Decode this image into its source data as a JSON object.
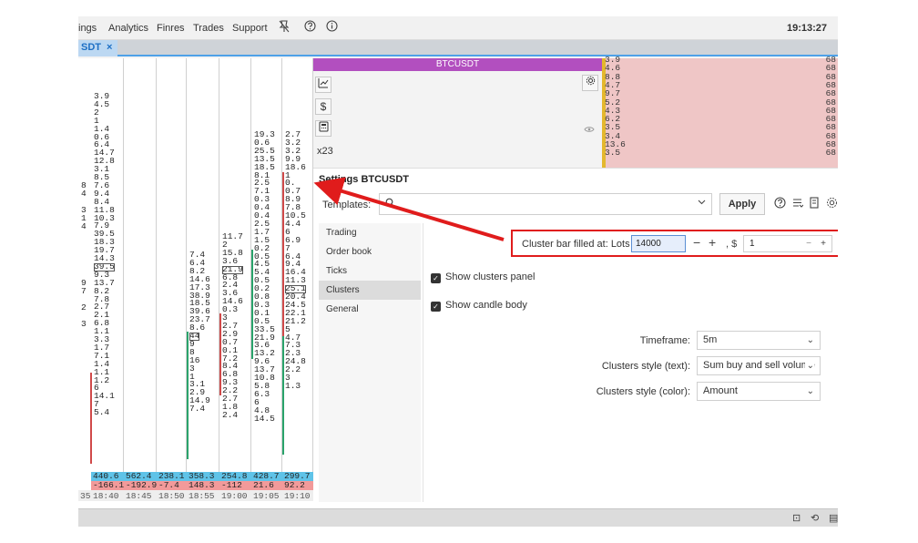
{
  "menu": {
    "items": [
      "ings",
      "Analytics",
      "Finres",
      "Trades",
      "Support"
    ],
    "clock": "19:13:27"
  },
  "tab": {
    "label": "SDT",
    "close": "×"
  },
  "cluster": {
    "columns": [
      {
        "cells": [
          {
            "t": "3.9"
          },
          {
            "t": "4.5"
          },
          {
            "t": "2"
          },
          {
            "t": "1"
          },
          {
            "t": "1.4"
          },
          {
            "t": "0.6"
          },
          {
            "t": "6.4"
          },
          {
            "t": "14.7"
          },
          {
            "t": "12.8"
          },
          {
            "t": "3.1"
          },
          {
            "t": "8.5"
          },
          {
            "t": "7.6"
          },
          {
            "t": "9.4"
          },
          {
            "t": "8.4"
          },
          {
            "t": "11.8"
          },
          {
            "t": "10.3"
          },
          {
            "t": "7.9"
          },
          {
            "t": "39.5"
          },
          {
            "t": "18.3"
          },
          {
            "t": "19.7"
          },
          {
            "t": "14.3"
          },
          {
            "t": "39.5",
            "box": true
          },
          {
            "t": "9.3"
          },
          {
            "t": "13.7"
          },
          {
            "t": "8.2"
          },
          {
            "t": "7.8"
          },
          {
            "t": "2.7"
          },
          {
            "t": "2.1"
          },
          {
            "t": "6.8"
          },
          {
            "t": "1.1"
          },
          {
            "t": "3.3"
          },
          {
            "t": "1.7"
          },
          {
            "t": "7.1"
          },
          {
            "t": "1.4"
          },
          {
            "t": "1.1"
          },
          {
            "t": "1.2"
          },
          {
            "t": "6"
          },
          {
            "t": "14.1"
          },
          {
            "t": "7"
          },
          {
            "t": "5.4"
          }
        ]
      },
      {
        "cells": []
      },
      {
        "cells": []
      },
      {
        "cells": [
          {
            "t": "7.4"
          },
          {
            "t": "6.4"
          },
          {
            "t": "8.2"
          },
          {
            "t": "14.6"
          },
          {
            "t": "17.3"
          },
          {
            "t": "38.9"
          },
          {
            "t": "18.5"
          },
          {
            "t": "39.6"
          },
          {
            "t": "23.7"
          },
          {
            "t": "8.6"
          },
          {
            "t": "44",
            "box": true
          },
          {
            "t": "9"
          },
          {
            "t": "8"
          },
          {
            "t": "16"
          },
          {
            "t": "3"
          },
          {
            "t": "1"
          },
          {
            "t": "3.1"
          },
          {
            "t": "2.9"
          },
          {
            "t": "14.9"
          },
          {
            "t": "7.4"
          }
        ]
      },
      {
        "cells": [
          {
            "t": "11.7"
          },
          {
            "t": "2"
          },
          {
            "t": "15.8"
          },
          {
            "t": "3.6"
          },
          {
            "t": "21.9",
            "box": true
          },
          {
            "t": "6.8"
          },
          {
            "t": "2.4"
          },
          {
            "t": "3.6"
          },
          {
            "t": "14.6"
          },
          {
            "t": "0.3"
          },
          {
            "t": "3"
          },
          {
            "t": "2.7"
          },
          {
            "t": "2.9"
          },
          {
            "t": "0.7"
          },
          {
            "t": "0.1"
          },
          {
            "t": "7.2"
          },
          {
            "t": "8.4"
          },
          {
            "t": "6.8"
          },
          {
            "t": "9.3"
          },
          {
            "t": "2.2"
          },
          {
            "t": "2.7"
          },
          {
            "t": "1.8"
          },
          {
            "t": "2.4"
          }
        ]
      },
      {
        "cells": [
          {
            "t": "19.3"
          },
          {
            "t": "0.6"
          },
          {
            "t": "25.5"
          },
          {
            "t": "13.5"
          },
          {
            "t": "18.5"
          },
          {
            "t": "8.1"
          },
          {
            "t": "2.5"
          },
          {
            "t": "7.1"
          },
          {
            "t": "0.3"
          },
          {
            "t": "0.4"
          },
          {
            "t": "0.4"
          },
          {
            "t": "2.5"
          },
          {
            "t": "1.7"
          },
          {
            "t": "1.5"
          },
          {
            "t": "0.2"
          },
          {
            "t": "0.5"
          },
          {
            "t": "4.5"
          },
          {
            "t": "5.4"
          },
          {
            "t": "0.5"
          },
          {
            "t": "0.2"
          },
          {
            "t": "0.8"
          },
          {
            "t": "0.3"
          },
          {
            "t": "0.1"
          },
          {
            "t": "0.5"
          },
          {
            "t": "33.5"
          },
          {
            "t": "21.9"
          },
          {
            "t": "3.6"
          },
          {
            "t": "13.2"
          },
          {
            "t": "9.6"
          },
          {
            "t": "13.7"
          },
          {
            "t": "10.8"
          },
          {
            "t": "5.8"
          },
          {
            "t": "6.3"
          },
          {
            "t": "6"
          },
          {
            "t": "4.8"
          },
          {
            "t": "14.5"
          }
        ]
      },
      {
        "cells": [
          {
            "t": "2.7"
          },
          {
            "t": "3.2"
          },
          {
            "t": "3.2"
          },
          {
            "t": "9.9"
          },
          {
            "t": "18.6"
          },
          {
            "t": "1"
          },
          {
            "t": "0."
          },
          {
            "t": "0.7"
          },
          {
            "t": "8.9"
          },
          {
            "t": "7.8"
          },
          {
            "t": "10.5"
          },
          {
            "t": "4.4"
          },
          {
            "t": "6"
          },
          {
            "t": "6.9"
          },
          {
            "t": "7"
          },
          {
            "t": "6.4"
          },
          {
            "t": "9.4"
          },
          {
            "t": "16.4"
          },
          {
            "t": "11.3"
          },
          {
            "t": "25.1",
            "box": true
          },
          {
            "t": "20.4"
          },
          {
            "t": "24.5"
          },
          {
            "t": "22.1"
          },
          {
            "t": "21.2"
          },
          {
            "t": "5"
          },
          {
            "t": "4.7"
          },
          {
            "t": "7.3"
          },
          {
            "t": "2.3"
          },
          {
            "t": "24.8"
          },
          {
            "t": "2.2"
          },
          {
            "t": "3"
          },
          {
            "t": "1.3"
          }
        ]
      }
    ],
    "left_fragments": [
      "8",
      "4",
      "3",
      "1",
      "4",
      "9",
      "7",
      "2",
      "3"
    ],
    "sum_top": [
      "440.6",
      "562.4",
      "238.1",
      "358.3",
      "254.8",
      "428.7",
      "299.7"
    ],
    "sum_bottom": [
      "-166.1",
      "-192.9",
      "-7.4",
      "148.3",
      "-112",
      "21.6",
      "92.2"
    ],
    "times": [
      "35",
      "18:40",
      "18:45",
      "18:50",
      "18:55",
      "19:00",
      "19:05",
      "19:10"
    ]
  },
  "widget": {
    "symbol": "BTCUSDT",
    "multiplier": "x23"
  },
  "prices": {
    "left": [
      "3.9",
      "4.6",
      "8.8",
      "4.7",
      "9.7",
      "5.2",
      "4.3",
      "6.2",
      "3.5",
      "3.4",
      "13.6",
      "3.5"
    ],
    "right": [
      "68",
      "68",
      "68",
      "68",
      "68",
      "68",
      "68",
      "68",
      "68",
      "68",
      "68",
      "68"
    ]
  },
  "settings": {
    "title": "Settings BTCUSDT",
    "templates_label": "Templates:",
    "apply_label": "Apply",
    "nav": [
      "Trading",
      "Order book",
      "Ticks",
      "Clusters",
      "General"
    ],
    "active_nav": "Clusters",
    "cluster_bar_label": "Cluster bar filled at: Lots",
    "cluster_bar_value": "14000",
    "cluster_bar_sep": ", $",
    "cluster_bar_usd": "1",
    "show_clusters_panel": "Show clusters panel",
    "show_candle_body": "Show candle body",
    "timeframe_label": "Timeframe:",
    "timeframe_value": "5m",
    "clusters_style_text_label": "Clusters style (text):",
    "clusters_style_text_value": "Sum buy and sell volume",
    "clusters_style_color_label": "Clusters style (color):",
    "clusters_style_color_value": "Amount"
  },
  "colors": {
    "accent_red": "#e01c1c",
    "symbol_header": "#b24fbf",
    "sum_positive": "#5fc3e8",
    "sum_negative": "#f29a9a"
  }
}
